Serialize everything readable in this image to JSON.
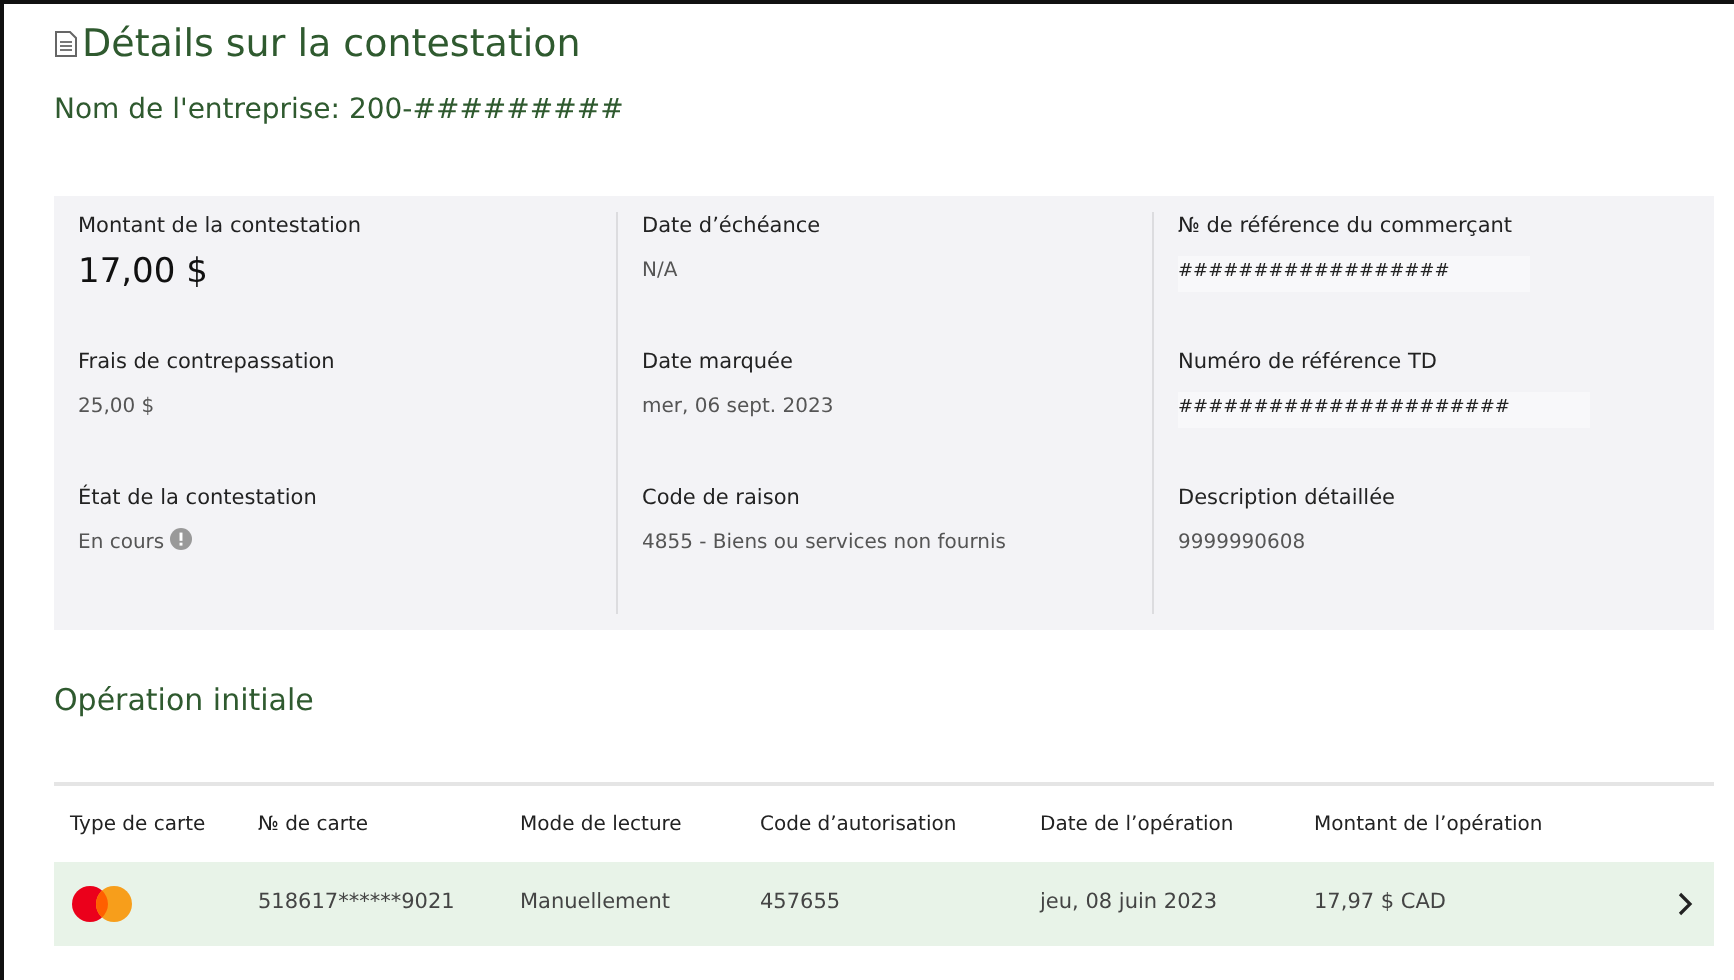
{
  "title": "Détails sur la contestation",
  "company": "Nom de l'entreprise: 200-#########",
  "details": [
    [
      {
        "label": "Montant de la contestation",
        "value": "17,00 $",
        "kind": "amount"
      },
      {
        "label": "Frais de contrepassation",
        "value": "25,00 $",
        "kind": "text"
      },
      {
        "label": "État de la contestation",
        "value": "En cours",
        "kind": "status"
      }
    ],
    [
      {
        "label": "Date d’échéance",
        "value": "N/A",
        "kind": "text"
      },
      {
        "label": "Date marquée",
        "value": "mer, 06 sept. 2023",
        "kind": "text"
      },
      {
        "label": "Code de raison",
        "value": "4855 - Biens ou services non fournis",
        "kind": "text"
      }
    ],
    [
      {
        "label": "№ de référence du commerçant",
        "value": "##################",
        "kind": "masked"
      },
      {
        "label": "Numéro de référence TD",
        "value": "######################",
        "kind": "masked"
      },
      {
        "label": "Description détaillée",
        "value": "9999990608",
        "kind": "text"
      }
    ]
  ],
  "operation": {
    "heading": "Opération initiale",
    "columns": [
      "Type de carte",
      "№ de carte",
      "Mode de lecture",
      "Code d’autorisation",
      "Date de l’opération",
      "Montant de l’opération"
    ],
    "rows": [
      {
        "selected": true,
        "cells": [
          "",
          "518617******9021",
          "Manuellement",
          "457655",
          "jeu, 08 juin 2023",
          "17,97 $ CAD"
        ]
      }
    ]
  }
}
